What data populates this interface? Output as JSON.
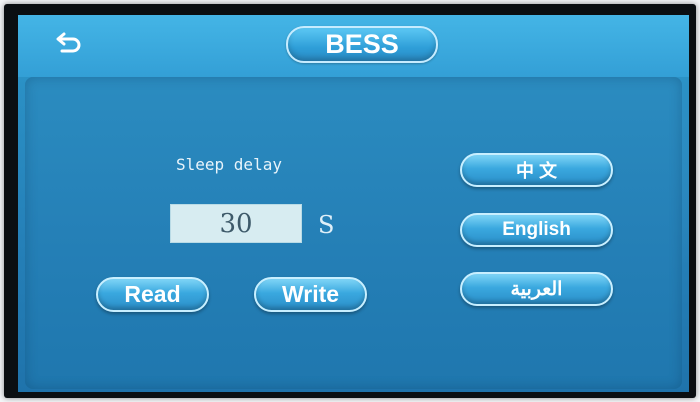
{
  "header": {
    "back_icon": "back-arrow-icon",
    "title": "BESS"
  },
  "settings": {
    "label": "Sleep delay",
    "value": "30",
    "unit": "S"
  },
  "actions": {
    "read_label": "Read",
    "write_label": "Write"
  },
  "languages": {
    "chinese": "中 文",
    "english": "English",
    "arabic": "العربية"
  },
  "colors": {
    "screen_blue": "#2a8fc4",
    "button_blue": "#3aa8df",
    "value_box": "#d7ecf1"
  }
}
